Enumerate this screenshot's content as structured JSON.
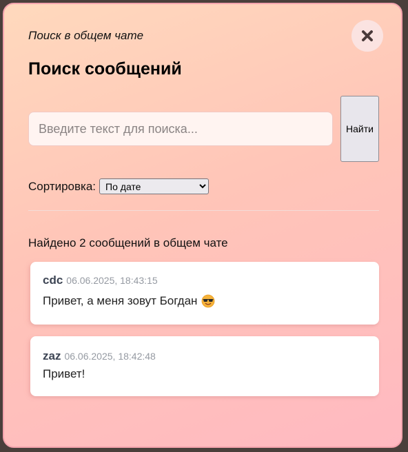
{
  "modal": {
    "subtitle": "Поиск в общем чате",
    "title": "Поиск сообщений",
    "close_icon": "close-icon"
  },
  "search": {
    "placeholder": "Введите текст для поиска...",
    "value": "",
    "button_label": "Найти"
  },
  "sort": {
    "label": "Сортировка:",
    "selected": "По дате"
  },
  "results": {
    "count_text": "Найдено 2 сообщений в общем чате",
    "items": [
      {
        "author": "cdc",
        "timestamp": "06.06.2025, 18:43:15",
        "text": "Привет, а меня зовут Богдан",
        "emoji": "smiling-face-with-sunglasses-icon"
      },
      {
        "author": "zaz",
        "timestamp": "06.06.2025, 18:42:48",
        "text": "Привет!"
      }
    ]
  },
  "colors": {
    "background_gradient_start": "#ffd9bd",
    "background_gradient_end": "#ffb9c1",
    "author_color": "#3d4554",
    "timestamp_color": "#959aa2"
  }
}
